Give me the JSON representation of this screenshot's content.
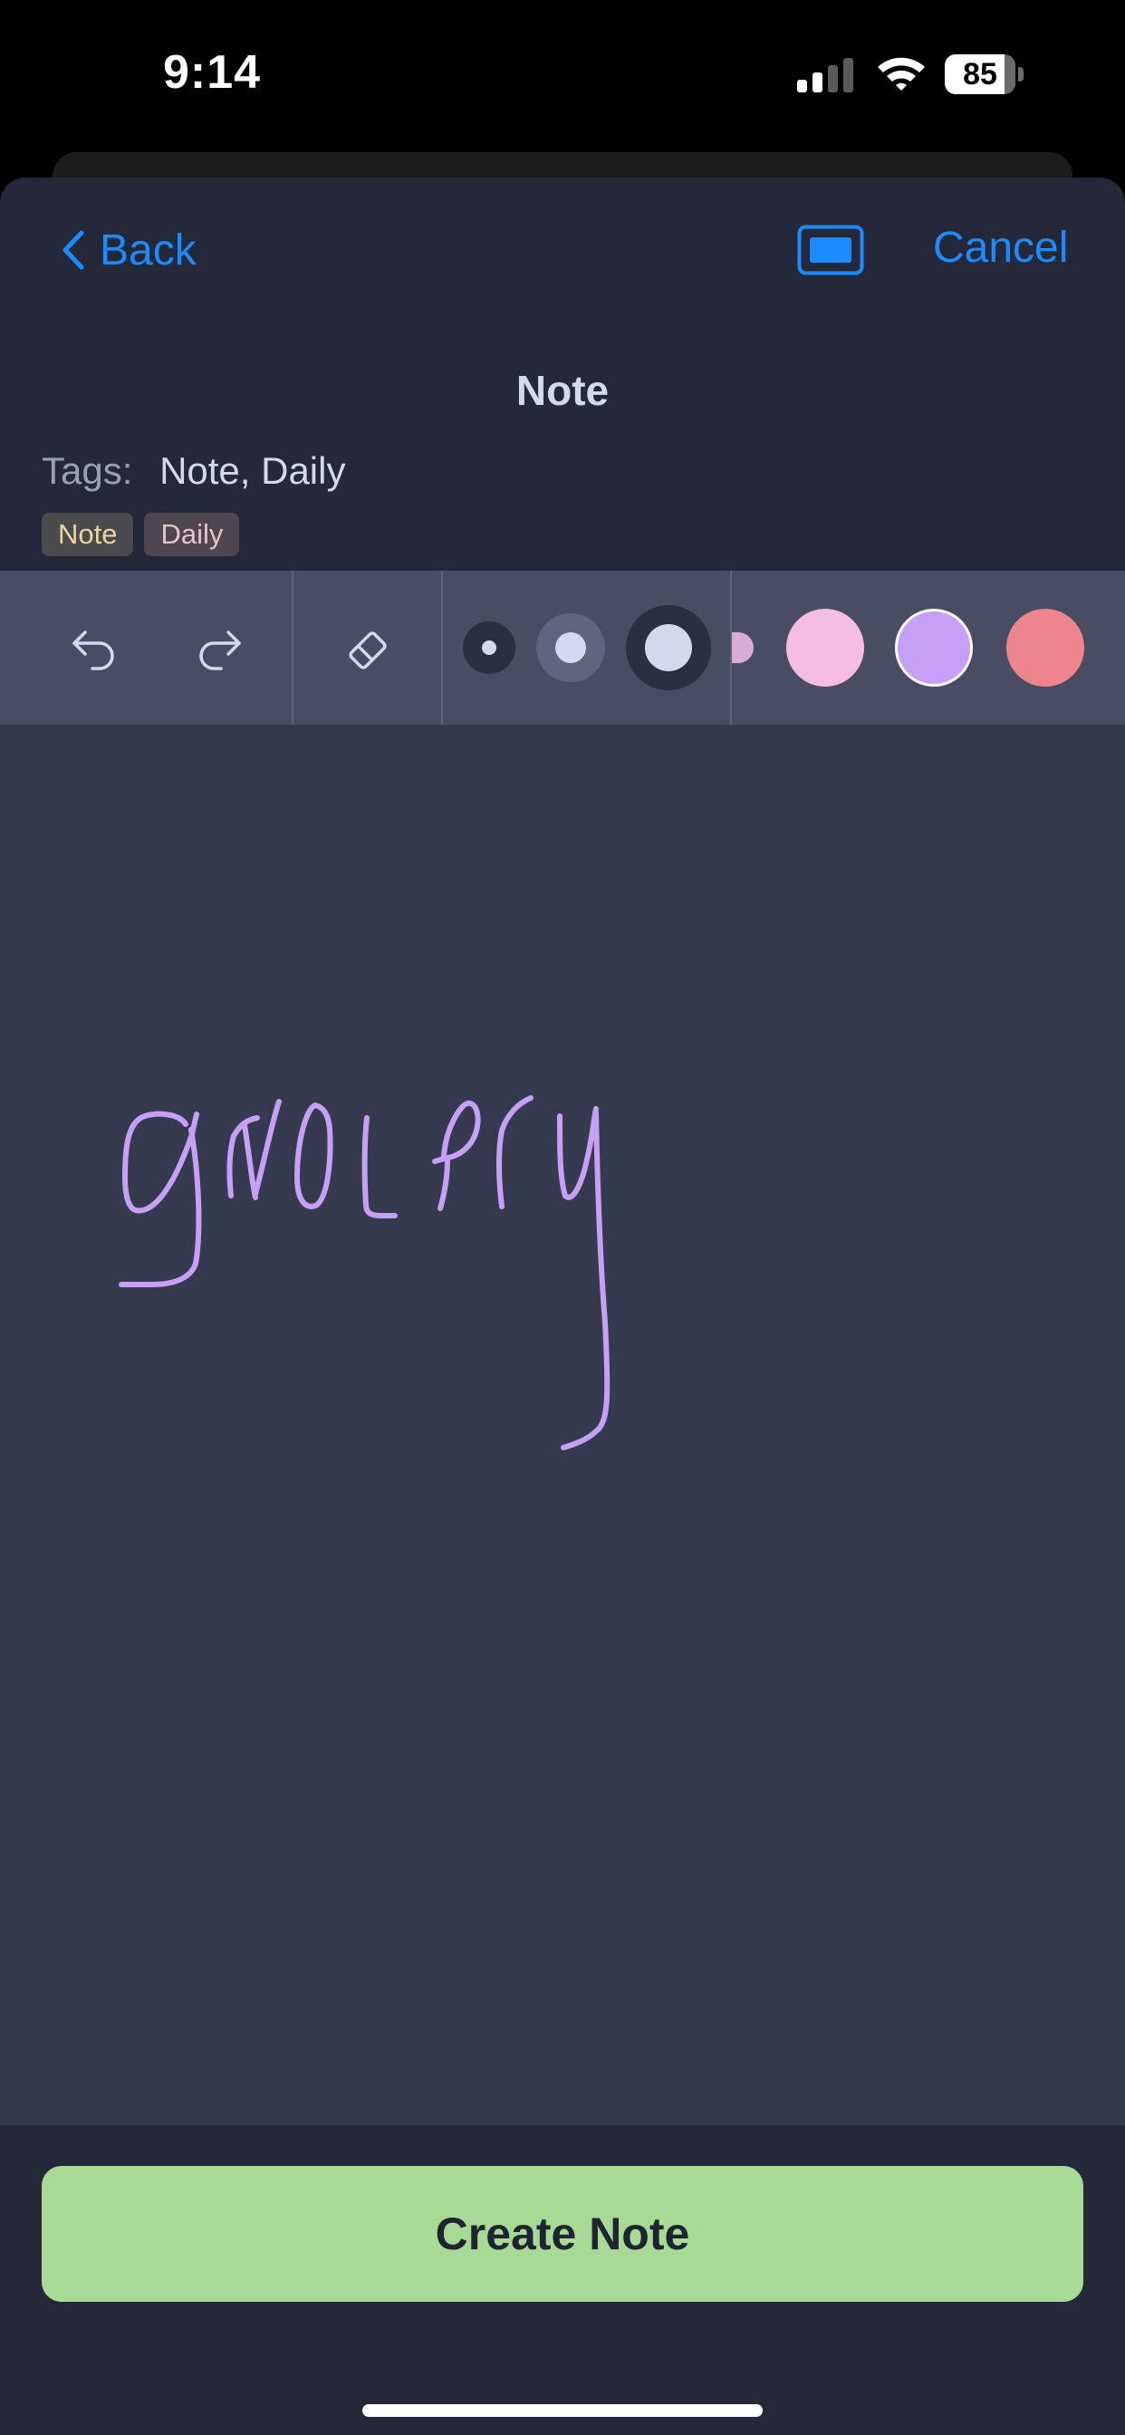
{
  "status_bar": {
    "time": "9:14",
    "battery_level": "85",
    "battery_fraction": 0.85,
    "icons": [
      "signal-icon",
      "wifi-icon",
      "battery-icon"
    ]
  },
  "nav": {
    "back_label": "Back",
    "cancel_label": "Cancel",
    "icons": [
      "chevron-left-icon",
      "screen-toggle-icon"
    ]
  },
  "title": "Note",
  "tags": {
    "label": "Tags:",
    "value": "Note, Daily",
    "chips": [
      "Note",
      "Daily"
    ]
  },
  "toolbar": {
    "tools": [
      "undo-icon",
      "redo-icon",
      "eraser-icon"
    ],
    "brush_sizes": [
      "small",
      "medium",
      "large"
    ],
    "selected_size": "large",
    "colors": [
      "#f5bde6",
      "#c6a0f6",
      "#ee858c"
    ],
    "selected_color": "#c6a0f6"
  },
  "canvas": {
    "ink_color": "#c6a0f6",
    "background": "#363a4f"
  },
  "actions": {
    "create_label": "Create Note"
  },
  "theme": {
    "accent": "#1a8cff",
    "button_green": "#a6da95",
    "sheet_bg": "#242838"
  }
}
